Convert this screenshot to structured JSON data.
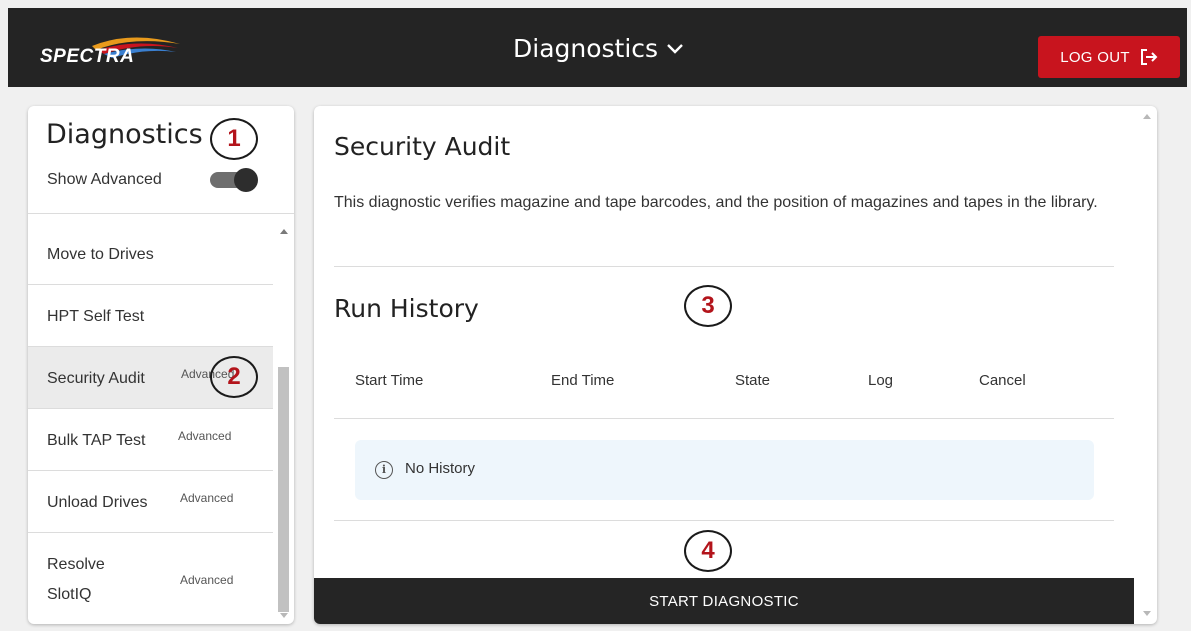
{
  "header": {
    "logo_text": "SPECTRA",
    "title": "Diagnostics",
    "logout_label": "LOG OUT"
  },
  "sidebar": {
    "title": "Diagnostics",
    "show_advanced_label": "Show Advanced",
    "show_advanced_on": true,
    "items": [
      {
        "label": "Move to Drives",
        "badge": ""
      },
      {
        "label": "HPT Self Test",
        "badge": ""
      },
      {
        "label": "Security Audit",
        "badge": "Advanced",
        "selected": true
      },
      {
        "label": "Bulk TAP Test",
        "badge": "Advanced"
      },
      {
        "label": "Unload Drives",
        "badge": "Advanced"
      },
      {
        "label": "Resolve SlotIQ",
        "line1": "Resolve",
        "line2": "SlotIQ",
        "badge": "Advanced"
      }
    ]
  },
  "main": {
    "title": "Security Audit",
    "description": "This diagnostic verifies magazine and tape barcodes, and the position of magazines and tapes in the library.",
    "history_title": "Run History",
    "columns": [
      "Start Time",
      "End Time",
      "State",
      "Log",
      "Cancel"
    ],
    "empty_message": "No History",
    "start_button": "START DIAGNOSTIC"
  },
  "callouts": [
    "1",
    "2",
    "3",
    "4"
  ],
  "colors": {
    "topbar": "#242424",
    "logout": "#c8141e",
    "callout_number": "#b3141b",
    "info_box": "#eef6fc"
  }
}
